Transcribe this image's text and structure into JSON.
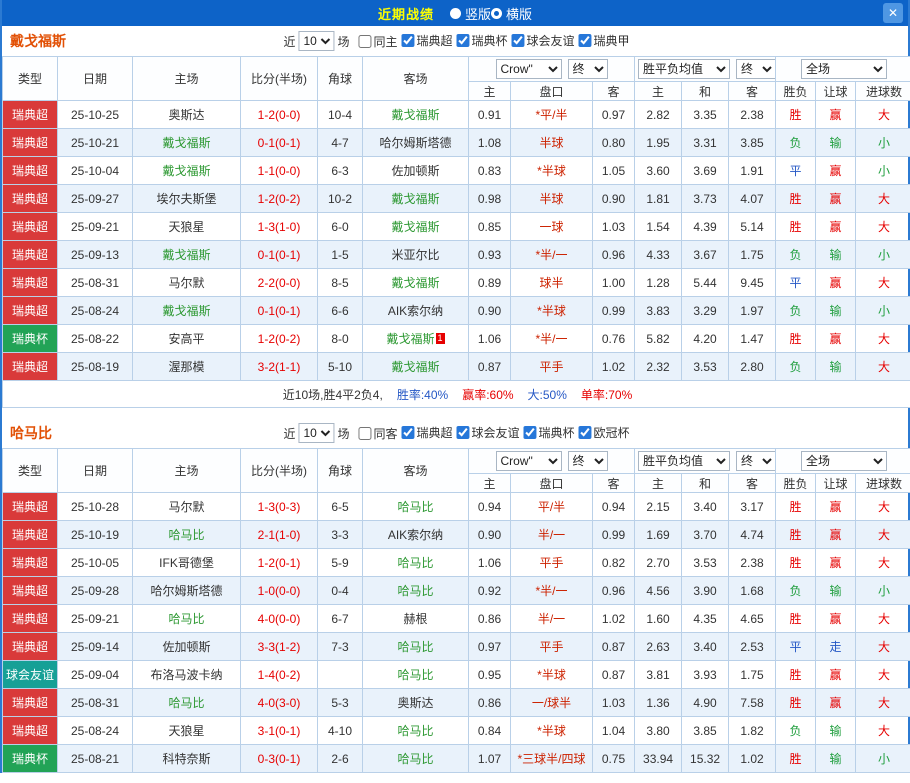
{
  "topbar": {
    "title": "近期战绩",
    "radios": [
      {
        "label": "竖版",
        "selected": false
      },
      {
        "label": "横版",
        "selected": true
      }
    ],
    "close_icon": "✕"
  },
  "colors": {
    "topbar_bg": "#0d63c8",
    "title": "#ffff00",
    "row_alt": "#e9f2fb",
    "border": "#b9d0e8",
    "focal_team": "#2e9933",
    "score": "#e60000",
    "handicap_text": "#cc2200",
    "win_red": "#e60000",
    "loss_green": "#1f9e3d",
    "draw_blue": "#2457c5",
    "team_title": "#e25005",
    "leagues": {
      "瑞典超": "#d93a3a",
      "瑞典杯": "#22a356",
      "球会友谊": "#16a096"
    }
  },
  "table_columns": [
    "类型",
    "日期",
    "主场",
    "比分(半场)",
    "角球",
    "客场",
    "主",
    "盘口",
    "客",
    "主",
    "和",
    "客",
    "胜负",
    "让球",
    "进球数"
  ],
  "sections": [
    {
      "team": "戴戈福斯",
      "near_label": "近",
      "count": "10",
      "unit_label": "场",
      "venue_filter": {
        "label": "同主",
        "checked": false
      },
      "league_filters": [
        {
          "label": "瑞典超",
          "checked": true
        },
        {
          "label": "瑞典杯",
          "checked": true
        },
        {
          "label": "球会友谊",
          "checked": true
        },
        {
          "label": "瑞典甲",
          "checked": true
        }
      ],
      "dropdowns": {
        "bookmaker": "Crow\"",
        "time1": "终",
        "avg": "胜平负均值",
        "time2": "终",
        "scope": "全场"
      },
      "rows": [
        {
          "league": "瑞典超",
          "date": "25-10-25",
          "home": "奥斯达",
          "homeFocal": false,
          "score": "1-2(0-0)",
          "corners": "10-4",
          "away": "戴戈福斯",
          "awayFocal": true,
          "badge": "",
          "ahHome": "0.91",
          "handicap": "*平/半",
          "ahAway": "0.97",
          "oHome": "2.82",
          "oDraw": "3.35",
          "oAway": "2.38",
          "result": "胜",
          "resultColor": "red",
          "hcResult": "赢",
          "hcColor": "red",
          "ouResult": "大",
          "ouColor": "red"
        },
        {
          "league": "瑞典超",
          "date": "25-10-21",
          "home": "戴戈福斯",
          "homeFocal": true,
          "score": "0-1(0-1)",
          "corners": "4-7",
          "away": "哈尔姆斯塔德",
          "awayFocal": false,
          "badge": "",
          "ahHome": "1.08",
          "handicap": "半球",
          "ahAway": "0.80",
          "oHome": "1.95",
          "oDraw": "3.31",
          "oAway": "3.85",
          "result": "负",
          "resultColor": "green",
          "hcResult": "输",
          "hcColor": "green",
          "ouResult": "小",
          "ouColor": "green"
        },
        {
          "league": "瑞典超",
          "date": "25-10-04",
          "home": "戴戈福斯",
          "homeFocal": true,
          "score": "1-1(0-0)",
          "corners": "6-3",
          "away": "佐加顿斯",
          "awayFocal": false,
          "badge": "",
          "ahHome": "0.83",
          "handicap": "*半球",
          "ahAway": "1.05",
          "oHome": "3.60",
          "oDraw": "3.69",
          "oAway": "1.91",
          "result": "平",
          "resultColor": "blue",
          "hcResult": "赢",
          "hcColor": "red",
          "ouResult": "小",
          "ouColor": "green"
        },
        {
          "league": "瑞典超",
          "date": "25-09-27",
          "home": "埃尔夫斯堡",
          "homeFocal": false,
          "score": "1-2(0-2)",
          "corners": "10-2",
          "away": "戴戈福斯",
          "awayFocal": true,
          "badge": "",
          "ahHome": "0.98",
          "handicap": "半球",
          "ahAway": "0.90",
          "oHome": "1.81",
          "oDraw": "3.73",
          "oAway": "4.07",
          "result": "胜",
          "resultColor": "red",
          "hcResult": "赢",
          "hcColor": "red",
          "ouResult": "大",
          "ouColor": "red"
        },
        {
          "league": "瑞典超",
          "date": "25-09-21",
          "home": "天狼星",
          "homeFocal": false,
          "score": "1-3(1-0)",
          "corners": "6-0",
          "away": "戴戈福斯",
          "awayFocal": true,
          "badge": "",
          "ahHome": "0.85",
          "handicap": "一球",
          "ahAway": "1.03",
          "oHome": "1.54",
          "oDraw": "4.39",
          "oAway": "5.14",
          "result": "胜",
          "resultColor": "red",
          "hcResult": "赢",
          "hcColor": "red",
          "ouResult": "大",
          "ouColor": "red"
        },
        {
          "league": "瑞典超",
          "date": "25-09-13",
          "home": "戴戈福斯",
          "homeFocal": true,
          "score": "0-1(0-1)",
          "corners": "1-5",
          "away": "米亚尔比",
          "awayFocal": false,
          "badge": "",
          "ahHome": "0.93",
          "handicap": "*半/一",
          "ahAway": "0.96",
          "oHome": "4.33",
          "oDraw": "3.67",
          "oAway": "1.75",
          "result": "负",
          "resultColor": "green",
          "hcResult": "输",
          "hcColor": "green",
          "ouResult": "小",
          "ouColor": "green"
        },
        {
          "league": "瑞典超",
          "date": "25-08-31",
          "home": "马尔默",
          "homeFocal": false,
          "score": "2-2(0-0)",
          "corners": "8-5",
          "away": "戴戈福斯",
          "awayFocal": true,
          "badge": "",
          "ahHome": "0.89",
          "handicap": "球半",
          "ahAway": "1.00",
          "oHome": "1.28",
          "oDraw": "5.44",
          "oAway": "9.45",
          "result": "平",
          "resultColor": "blue",
          "hcResult": "赢",
          "hcColor": "red",
          "ouResult": "大",
          "ouColor": "red"
        },
        {
          "league": "瑞典超",
          "date": "25-08-24",
          "home": "戴戈福斯",
          "homeFocal": true,
          "score": "0-1(0-1)",
          "corners": "6-6",
          "away": "AIK索尔纳",
          "awayFocal": false,
          "badge": "",
          "ahHome": "0.90",
          "handicap": "*半球",
          "ahAway": "0.99",
          "oHome": "3.83",
          "oDraw": "3.29",
          "oAway": "1.97",
          "result": "负",
          "resultColor": "green",
          "hcResult": "输",
          "hcColor": "green",
          "ouResult": "小",
          "ouColor": "green"
        },
        {
          "league": "瑞典杯",
          "date": "25-08-22",
          "home": "安高平",
          "homeFocal": false,
          "score": "1-2(0-2)",
          "corners": "8-0",
          "away": "戴戈福斯",
          "awayFocal": true,
          "badge": "1",
          "ahHome": "1.06",
          "handicap": "*半/一",
          "ahAway": "0.76",
          "oHome": "5.82",
          "oDraw": "4.20",
          "oAway": "1.47",
          "result": "胜",
          "resultColor": "red",
          "hcResult": "赢",
          "hcColor": "red",
          "ouResult": "大",
          "ouColor": "red"
        },
        {
          "league": "瑞典超",
          "date": "25-08-19",
          "home": "渥那模",
          "homeFocal": false,
          "score": "3-2(1-1)",
          "corners": "5-10",
          "away": "戴戈福斯",
          "awayFocal": true,
          "badge": "",
          "ahHome": "0.87",
          "handicap": "平手",
          "ahAway": "1.02",
          "oHome": "2.32",
          "oDraw": "3.53",
          "oAway": "2.80",
          "result": "负",
          "resultColor": "green",
          "hcResult": "输",
          "hcColor": "green",
          "ouResult": "大",
          "ouColor": "red"
        }
      ],
      "summary": [
        {
          "text": "近10场,胜4平2负4,",
          "color": ""
        },
        {
          "text": "胜率:40%",
          "color": "blue"
        },
        {
          "text": "赢率:60%",
          "color": "red"
        },
        {
          "text": "大:50%",
          "color": "blue"
        },
        {
          "text": "单率:70%",
          "color": "red"
        }
      ]
    },
    {
      "team": "哈马比",
      "near_label": "近",
      "count": "10",
      "unit_label": "场",
      "venue_filter": {
        "label": "同客",
        "checked": false
      },
      "league_filters": [
        {
          "label": "瑞典超",
          "checked": true
        },
        {
          "label": "球会友谊",
          "checked": true
        },
        {
          "label": "瑞典杯",
          "checked": true
        },
        {
          "label": "欧冠杯",
          "checked": true
        }
      ],
      "dropdowns": {
        "bookmaker": "Crow\"",
        "time1": "终",
        "avg": "胜平负均值",
        "time2": "终",
        "scope": "全场"
      },
      "rows": [
        {
          "league": "瑞典超",
          "date": "25-10-28",
          "home": "马尔默",
          "homeFocal": false,
          "score": "1-3(0-3)",
          "corners": "6-5",
          "away": "哈马比",
          "awayFocal": true,
          "badge": "",
          "ahHome": "0.94",
          "handicap": "平/半",
          "ahAway": "0.94",
          "oHome": "2.15",
          "oDraw": "3.40",
          "oAway": "3.17",
          "result": "胜",
          "resultColor": "red",
          "hcResult": "赢",
          "hcColor": "red",
          "ouResult": "大",
          "ouColor": "red"
        },
        {
          "league": "瑞典超",
          "date": "25-10-19",
          "home": "哈马比",
          "homeFocal": true,
          "score": "2-1(1-0)",
          "corners": "3-3",
          "away": "AIK索尔纳",
          "awayFocal": false,
          "badge": "",
          "ahHome": "0.90",
          "handicap": "半/一",
          "ahAway": "0.99",
          "oHome": "1.69",
          "oDraw": "3.70",
          "oAway": "4.74",
          "result": "胜",
          "resultColor": "red",
          "hcResult": "赢",
          "hcColor": "red",
          "ouResult": "大",
          "ouColor": "red"
        },
        {
          "league": "瑞典超",
          "date": "25-10-05",
          "home": "IFK哥德堡",
          "homeFocal": false,
          "score": "1-2(0-1)",
          "corners": "5-9",
          "away": "哈马比",
          "awayFocal": true,
          "badge": "",
          "ahHome": "1.06",
          "handicap": "平手",
          "ahAway": "0.82",
          "oHome": "2.70",
          "oDraw": "3.53",
          "oAway": "2.38",
          "result": "胜",
          "resultColor": "red",
          "hcResult": "赢",
          "hcColor": "red",
          "ouResult": "大",
          "ouColor": "red"
        },
        {
          "league": "瑞典超",
          "date": "25-09-28",
          "home": "哈尔姆斯塔德",
          "homeFocal": false,
          "score": "1-0(0-0)",
          "corners": "0-4",
          "away": "哈马比",
          "awayFocal": true,
          "badge": "",
          "ahHome": "0.92",
          "handicap": "*半/一",
          "ahAway": "0.96",
          "oHome": "4.56",
          "oDraw": "3.90",
          "oAway": "1.68",
          "result": "负",
          "resultColor": "green",
          "hcResult": "输",
          "hcColor": "green",
          "ouResult": "小",
          "ouColor": "green"
        },
        {
          "league": "瑞典超",
          "date": "25-09-21",
          "home": "哈马比",
          "homeFocal": true,
          "score": "4-0(0-0)",
          "corners": "6-7",
          "away": "赫根",
          "awayFocal": false,
          "badge": "",
          "ahHome": "0.86",
          "handicap": "半/一",
          "ahAway": "1.02",
          "oHome": "1.60",
          "oDraw": "4.35",
          "oAway": "4.65",
          "result": "胜",
          "resultColor": "red",
          "hcResult": "赢",
          "hcColor": "red",
          "ouResult": "大",
          "ouColor": "red"
        },
        {
          "league": "瑞典超",
          "date": "25-09-14",
          "home": "佐加顿斯",
          "homeFocal": false,
          "score": "3-3(1-2)",
          "corners": "7-3",
          "away": "哈马比",
          "awayFocal": true,
          "badge": "",
          "ahHome": "0.97",
          "handicap": "平手",
          "ahAway": "0.87",
          "oHome": "2.63",
          "oDraw": "3.40",
          "oAway": "2.53",
          "result": "平",
          "resultColor": "blue",
          "hcResult": "走",
          "hcColor": "blue",
          "ouResult": "大",
          "ouColor": "red"
        },
        {
          "league": "球会友谊",
          "date": "25-09-04",
          "home": "布洛马波卡纳",
          "homeFocal": false,
          "score": "1-4(0-2)",
          "corners": "",
          "away": "哈马比",
          "awayFocal": true,
          "badge": "",
          "ahHome": "0.95",
          "handicap": "*半球",
          "ahAway": "0.87",
          "oHome": "3.81",
          "oDraw": "3.93",
          "oAway": "1.75",
          "result": "胜",
          "resultColor": "red",
          "hcResult": "赢",
          "hcColor": "red",
          "ouResult": "大",
          "ouColor": "red"
        },
        {
          "league": "瑞典超",
          "date": "25-08-31",
          "home": "哈马比",
          "homeFocal": true,
          "score": "4-0(3-0)",
          "corners": "5-3",
          "away": "奥斯达",
          "awayFocal": false,
          "badge": "",
          "ahHome": "0.86",
          "handicap": "一/球半",
          "ahAway": "1.03",
          "oHome": "1.36",
          "oDraw": "4.90",
          "oAway": "7.58",
          "result": "胜",
          "resultColor": "red",
          "hcResult": "赢",
          "hcColor": "red",
          "ouResult": "大",
          "ouColor": "red"
        },
        {
          "league": "瑞典超",
          "date": "25-08-24",
          "home": "天狼星",
          "homeFocal": false,
          "score": "3-1(0-1)",
          "corners": "4-10",
          "away": "哈马比",
          "awayFocal": true,
          "badge": "",
          "ahHome": "0.84",
          "handicap": "*半球",
          "ahAway": "1.04",
          "oHome": "3.80",
          "oDraw": "3.85",
          "oAway": "1.82",
          "result": "负",
          "resultColor": "green",
          "hcResult": "输",
          "hcColor": "green",
          "ouResult": "大",
          "ouColor": "red"
        },
        {
          "league": "瑞典杯",
          "date": "25-08-21",
          "home": "科特奈斯",
          "homeFocal": false,
          "score": "0-3(0-1)",
          "corners": "2-6",
          "away": "哈马比",
          "awayFocal": true,
          "badge": "",
          "ahHome": "1.07",
          "handicap": "*三球半/四球",
          "ahAway": "0.75",
          "oHome": "33.94",
          "oDraw": "15.32",
          "oAway": "1.02",
          "result": "胜",
          "resultColor": "red",
          "hcResult": "输",
          "hcColor": "green",
          "ouResult": "小",
          "ouColor": "green"
        }
      ],
      "summary": null
    }
  ]
}
